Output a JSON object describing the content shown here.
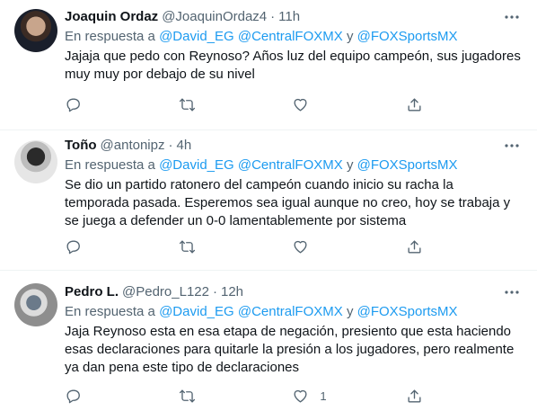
{
  "replying_prefix": "En respuesta a",
  "and_word": "y",
  "tweets": [
    {
      "name": "Joaquin Ordaz",
      "handle": "@JoaquinOrdaz4",
      "sep": "·",
      "time": "11h",
      "mentions": [
        "@David_EG",
        "@CentralFOXMX",
        "@FOXSportsMX"
      ],
      "text_lines": [
        "Jajaja que pedo con Reynoso? Años luz del equipo campeón, sus jugadores",
        "muy muy por debajo de su nivel"
      ],
      "likes": ""
    },
    {
      "name": "Toño",
      "handle": "@antonipz",
      "sep": "·",
      "time": "4h",
      "mentions": [
        "@David_EG",
        "@CentralFOXMX",
        "@FOXSportsMX"
      ],
      "text_lines": [
        "Se dio un partido ratonero del campeón cuando inicio su racha la",
        "temporada pasada. Esperemos sea igual aunque no creo, hoy se trabaja y",
        "se juega a defender un 0-0  lamentablemente por sistema"
      ],
      "likes": ""
    },
    {
      "name": "Pedro L.",
      "handle": "@Pedro_L122",
      "sep": "·",
      "time": "12h",
      "mentions": [
        "@David_EG",
        "@CentralFOXMX",
        "@FOXSportsMX"
      ],
      "text_lines": [
        "Jaja Reynoso esta en esa etapa de negación, presiento que esta haciendo",
        "esas declaraciones para quitarle la presión a los jugadores, pero realmente",
        "ya dan pena este tipo de declaraciones"
      ],
      "likes": "1"
    }
  ],
  "colors": {
    "link": "#1d9bf0",
    "muted": "#536471",
    "text": "#0f1419",
    "divider": "#eff3f4"
  },
  "icons": [
    "more-icon",
    "reply-icon",
    "retweet-icon",
    "like-icon",
    "share-icon"
  ]
}
